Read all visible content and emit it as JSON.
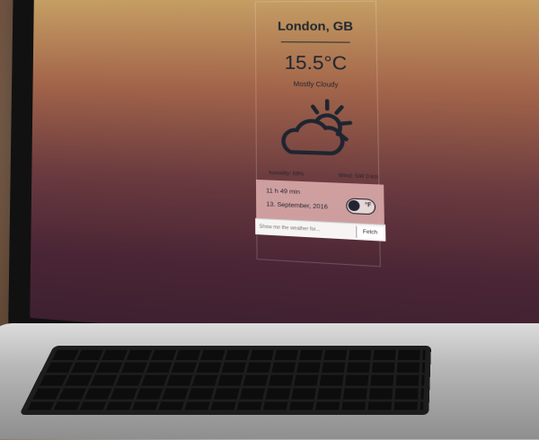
{
  "weather": {
    "location": "London, GB",
    "temperature": "15.5°C",
    "condition": "Mostly Cloudy",
    "icon": "partly-cloudy-day-icon",
    "humidity_label": "humidity: 68%",
    "wind_label": "Wind: SW 0 km",
    "time": "11 h 49 min",
    "date": "13. September, 2016",
    "unit_toggle_label": "°F"
  },
  "search": {
    "placeholder": "Show me the weather for...",
    "button_label": "Fetch"
  }
}
